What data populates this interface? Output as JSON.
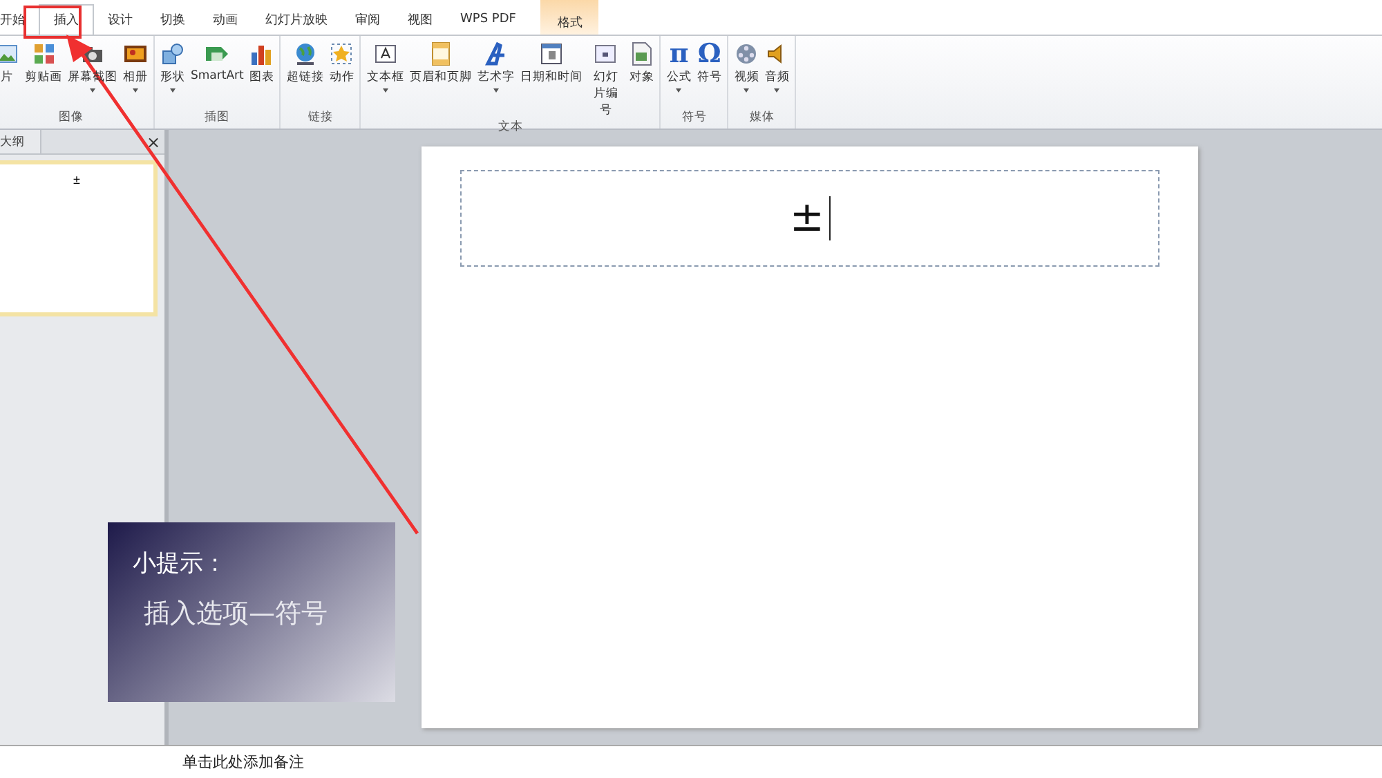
{
  "tabs": [
    {
      "label": "开始",
      "selected": false,
      "kind": "normal"
    },
    {
      "label": "插入",
      "selected": true,
      "kind": "normal"
    },
    {
      "label": "设计",
      "selected": false,
      "kind": "normal"
    },
    {
      "label": "切换",
      "selected": false,
      "kind": "normal"
    },
    {
      "label": "动画",
      "selected": false,
      "kind": "normal"
    },
    {
      "label": "幻灯片放映",
      "selected": false,
      "kind": "normal"
    },
    {
      "label": "审阅",
      "selected": false,
      "kind": "normal"
    },
    {
      "label": "视图",
      "selected": false,
      "kind": "normal"
    },
    {
      "label": "WPS PDF",
      "selected": false,
      "kind": "normal"
    },
    {
      "label": "格式",
      "selected": false,
      "kind": "contextual"
    }
  ],
  "ribbon": {
    "groups": [
      {
        "label": "图像",
        "buttons": [
          {
            "label": "片",
            "dropdown": false
          },
          {
            "label": "剪贴画",
            "dropdown": false
          },
          {
            "label": "屏幕截图",
            "dropdown": true
          },
          {
            "label": "相册",
            "dropdown": true
          }
        ]
      },
      {
        "label": "插图",
        "buttons": [
          {
            "label": "形状",
            "dropdown": true
          },
          {
            "label": "SmartArt",
            "dropdown": false
          },
          {
            "label": "图表",
            "dropdown": false
          }
        ]
      },
      {
        "label": "链接",
        "buttons": [
          {
            "label": "超链接",
            "dropdown": false
          },
          {
            "label": "动作",
            "dropdown": false
          }
        ]
      },
      {
        "label": "文本",
        "buttons": [
          {
            "label": "文本框",
            "dropdown": true
          },
          {
            "label": "页眉和页脚",
            "dropdown": false
          },
          {
            "label": "艺术字",
            "dropdown": true
          },
          {
            "label": "日期和时间",
            "dropdown": false
          },
          {
            "label": "幻灯片编号",
            "dropdown": false
          },
          {
            "label": "对象",
            "dropdown": false
          }
        ]
      },
      {
        "label": "符号",
        "buttons": [
          {
            "label": "公式",
            "glyph": "π",
            "dropdown": true
          },
          {
            "label": "符号",
            "glyph": "Ω",
            "dropdown": false
          }
        ]
      },
      {
        "label": "媒体",
        "buttons": [
          {
            "label": "视频",
            "dropdown": true
          },
          {
            "label": "音频",
            "dropdown": true
          }
        ]
      }
    ]
  },
  "slide_panel": {
    "tab": "大纲",
    "close": "×",
    "thumbnails": [
      {
        "text": "±",
        "selected": true
      }
    ]
  },
  "slide": {
    "title_box": {
      "text": "±",
      "editing": true
    }
  },
  "notes": {
    "placeholder": "单击此处添加备注"
  },
  "hint": {
    "title": "小提示：",
    "body": "插入选项—符号"
  }
}
